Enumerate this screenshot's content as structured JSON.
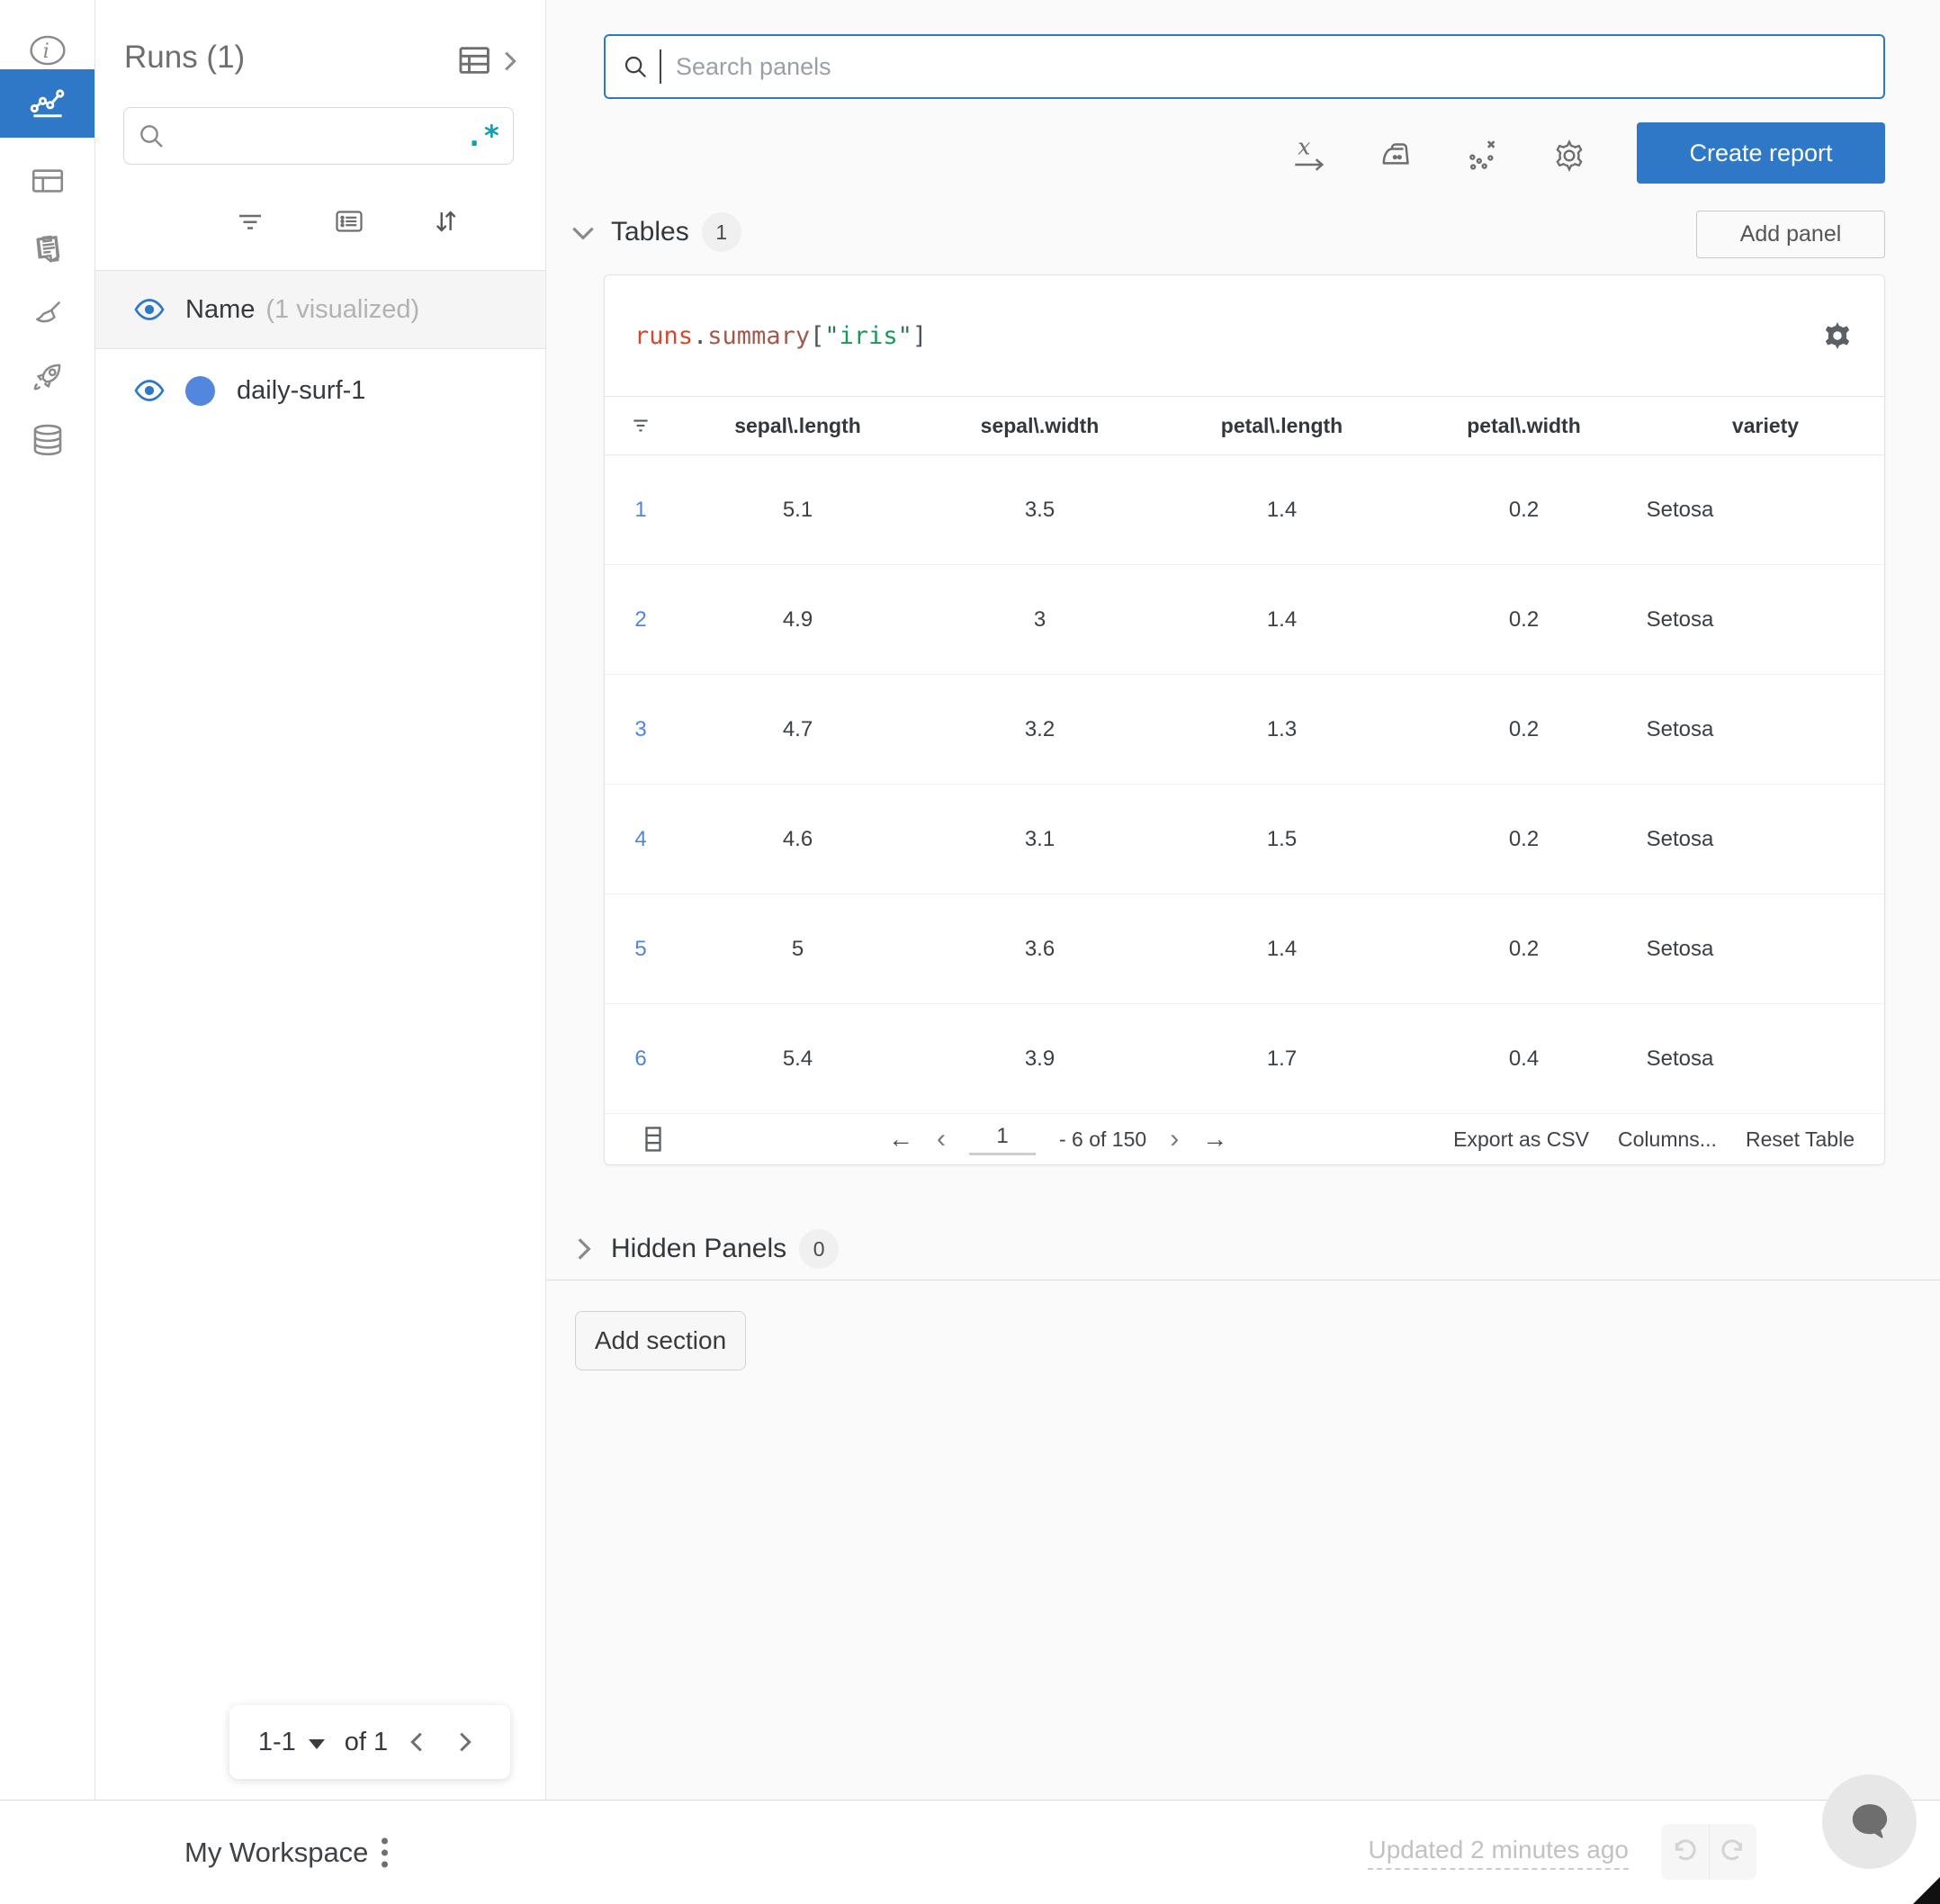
{
  "colors": {
    "accent_blue": "#2e78c7",
    "teal_regex": "#0aa2b5",
    "run_dot": "#5387dd",
    "row_link": "#5285d6"
  },
  "left_rail": {
    "selected": "line-chart",
    "items": [
      "info",
      "line-chart",
      "panels",
      "clipboard",
      "broom",
      "rocket",
      "database"
    ]
  },
  "sidebar": {
    "title": "Runs (1)",
    "search": {
      "value": "",
      "regex_label": ".*"
    },
    "name_row": {
      "label": "Name",
      "sublabel": "(1 visualized)"
    },
    "runs": [
      {
        "name": "daily-surf-1"
      }
    ],
    "pagination": {
      "range": "1-1",
      "of_label": "of 1"
    }
  },
  "topbar": {
    "search_placeholder": "Search panels",
    "create_report": "Create report"
  },
  "tables_section": {
    "label": "Tables",
    "count": "1",
    "add_panel": "Add panel"
  },
  "panel": {
    "title": {
      "obj": "runs",
      "dot": ".",
      "attr": "summary",
      "lbracket": "[",
      "quote_open": "\"",
      "key": "iris",
      "quote_close": "\"",
      "rbracket": "]"
    },
    "table": {
      "columns": [
        "sepal\\.length",
        "sepal\\.width",
        "petal\\.length",
        "petal\\.width",
        "variety"
      ],
      "rows": [
        {
          "idx": "1",
          "cells": [
            "5.1",
            "3.5",
            "1.4",
            "0.2",
            "Setosa"
          ]
        },
        {
          "idx": "2",
          "cells": [
            "4.9",
            "3",
            "1.4",
            "0.2",
            "Setosa"
          ]
        },
        {
          "idx": "3",
          "cells": [
            "4.7",
            "3.2",
            "1.3",
            "0.2",
            "Setosa"
          ]
        },
        {
          "idx": "4",
          "cells": [
            "4.6",
            "3.1",
            "1.5",
            "0.2",
            "Setosa"
          ]
        },
        {
          "idx": "5",
          "cells": [
            "5",
            "3.6",
            "1.4",
            "0.2",
            "Setosa"
          ]
        },
        {
          "idx": "6",
          "cells": [
            "5.4",
            "3.9",
            "1.7",
            "0.4",
            "Setosa"
          ]
        }
      ],
      "footer": {
        "page": "1",
        "range": "- 6 of 150",
        "prev_page": "←",
        "prev": "‹",
        "next": "›",
        "next_page": "→",
        "export": "Export as CSV",
        "columns": "Columns...",
        "reset": "Reset Table"
      }
    }
  },
  "hidden_section": {
    "label": "Hidden Panels",
    "count": "0"
  },
  "add_section_label": "Add section",
  "bottom_bar": {
    "workspace": "My Workspace",
    "updated": "Updated 2 minutes ago"
  }
}
